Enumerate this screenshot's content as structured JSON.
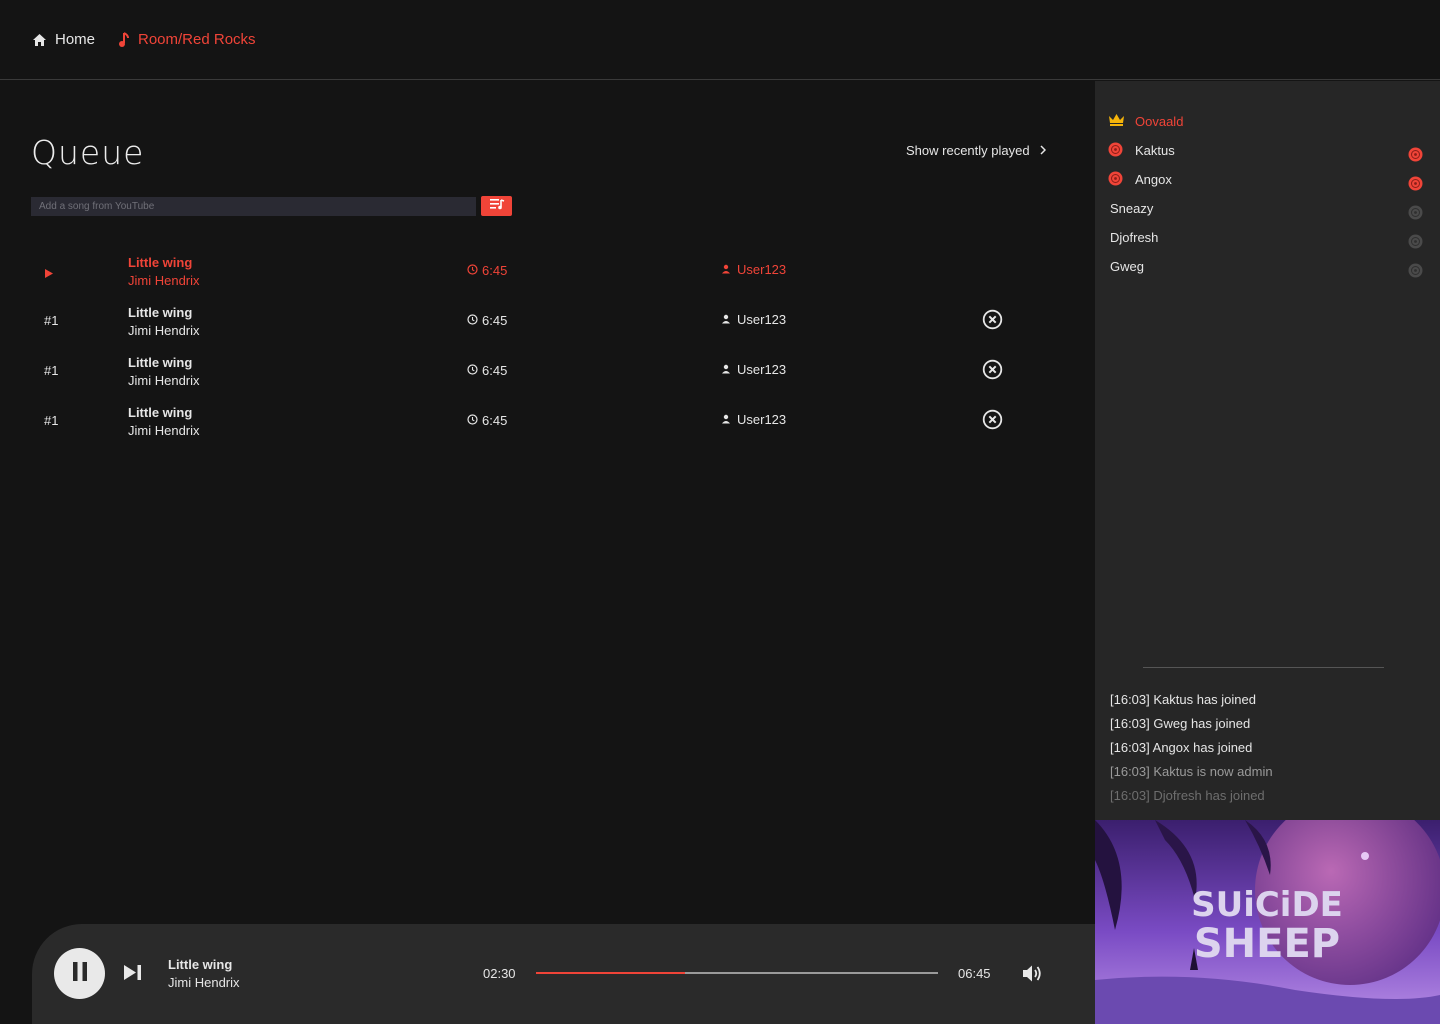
{
  "nav": {
    "home_label": "Home",
    "room_label": "Room/Red Rocks"
  },
  "queue": {
    "title": "Queue",
    "recent_label": "Show recently played",
    "add_placeholder": "Add a song from YouTube",
    "rows": [
      {
        "position": "",
        "title": "Little wing",
        "artist": "Jimi Hendrix",
        "duration": "6:45",
        "user": "User123",
        "state": "playing"
      },
      {
        "position": "#1",
        "title": "Little wing",
        "artist": "Jimi Hendrix",
        "duration": "6:45",
        "user": "User123",
        "state": "queued"
      },
      {
        "position": "#1",
        "title": "Little wing",
        "artist": "Jimi Hendrix",
        "duration": "6:45",
        "user": "User123",
        "state": "queued"
      },
      {
        "position": "#1",
        "title": "Little wing",
        "artist": "Jimi Hendrix",
        "duration": "6:45",
        "user": "User123",
        "state": "queued"
      }
    ]
  },
  "members": [
    {
      "name": "Oovaald",
      "role": "owner",
      "icon": "crown-icon",
      "recording": null
    },
    {
      "name": "Kaktus",
      "role": "admin",
      "icon": "record-icon",
      "recording": true
    },
    {
      "name": "Angox",
      "role": "admin",
      "icon": "record-icon",
      "recording": true
    },
    {
      "name": "Sneazy",
      "role": "member",
      "icon": null,
      "recording": false
    },
    {
      "name": "Djofresh",
      "role": "member",
      "icon": null,
      "recording": false
    },
    {
      "name": "Gweg",
      "role": "member",
      "icon": null,
      "recording": false
    }
  ],
  "log": [
    {
      "text": "[16:03] Kaktus has joined",
      "color": "#e6e6e6"
    },
    {
      "text": "[16:03] Gweg has joined",
      "color": "#e6e6e6"
    },
    {
      "text": "[16:03] Angox has joined",
      "color": "#e6e6e6"
    },
    {
      "text": "[16:03] Kaktus is now admin",
      "color": "#9a9a9a"
    },
    {
      "text": "[16:03] Djofresh has joined",
      "color": "#6e6e6e"
    }
  ],
  "player": {
    "title": "Little wing",
    "artist": "Jimi Hendrix",
    "elapsed": "02:30",
    "total": "06:45",
    "progress": 0.37
  },
  "album_art": {
    "text_line1": "SUiCiDE",
    "text_line2": "SHEEP"
  },
  "colors": {
    "accent": "#f04438",
    "crown": "#f5b40a",
    "background": "#141414",
    "sidebar": "#262626",
    "player_bar": "#2a2a2a"
  }
}
